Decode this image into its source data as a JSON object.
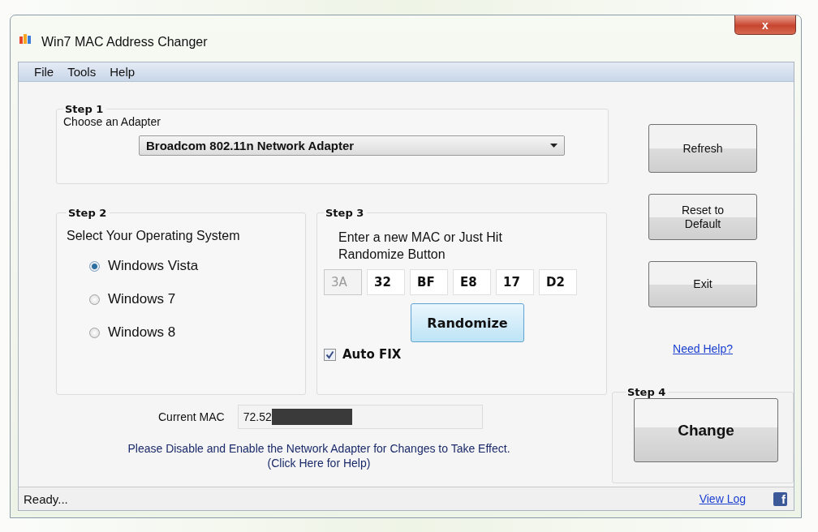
{
  "window": {
    "title": "Win7 MAC Address Changer",
    "close": "x"
  },
  "menu": [
    {
      "label": "File"
    },
    {
      "label": "Tools"
    },
    {
      "label": "Help"
    }
  ],
  "step1": {
    "title": "Step 1",
    "label": "Choose an Adapter",
    "adapter": "Broadcom 802.11n Network Adapter"
  },
  "step2": {
    "title": "Step 2",
    "label": "Select Your Operating System",
    "options": [
      {
        "label": "Windows Vista",
        "selected": true
      },
      {
        "label": "Windows 7",
        "selected": false
      },
      {
        "label": "Windows 8",
        "selected": false
      }
    ]
  },
  "step3": {
    "title": "Step 3",
    "instruction": "Enter a new MAC or Just Hit Randomize Button",
    "octets": [
      {
        "value": "3A",
        "disabled": true
      },
      {
        "value": "32",
        "disabled": false
      },
      {
        "value": "BF",
        "disabled": false
      },
      {
        "value": "E8",
        "disabled": false
      },
      {
        "value": "17",
        "disabled": false
      },
      {
        "value": "D2",
        "disabled": false
      }
    ],
    "randomize": "Randomize",
    "auto_fix": {
      "label": "Auto FIX",
      "checked": true
    }
  },
  "current_mac": {
    "label": "Current MAC",
    "value": "72.52"
  },
  "notice": [
    "Please Disable and Enable the Network Adapter for Changes to Take Effect.",
    "(Click Here for Help)"
  ],
  "side_buttons": [
    "Refresh",
    "Reset to Default",
    "Exit"
  ],
  "help_link": "Need Help?",
  "step4": {
    "title": "Step 4",
    "button": "Change"
  },
  "status_bar": {
    "text": "Ready...",
    "link": "View Log",
    "social": "f"
  }
}
